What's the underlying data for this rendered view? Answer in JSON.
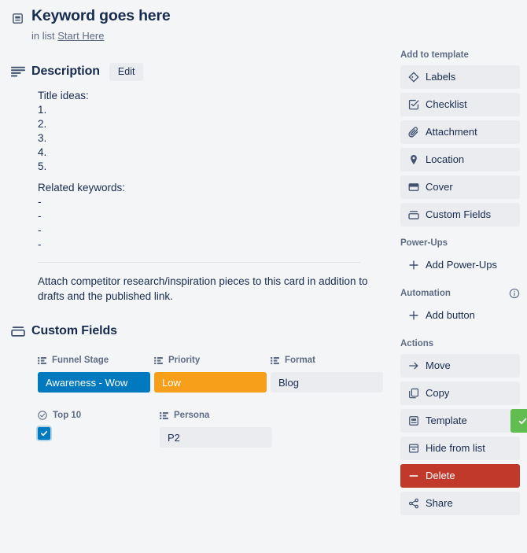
{
  "header": {
    "icon": "template-card-icon",
    "title": "Keyword goes here",
    "in_list_prefix": "in list",
    "list_name": "Start Here"
  },
  "description": {
    "icon": "description-lines-icon",
    "title": "Description",
    "edit_label": "Edit",
    "lines": [
      "Title ideas:",
      "1.",
      "2.",
      "3.",
      "4.",
      "5."
    ],
    "lines2": [
      "Related keywords:",
      "-",
      "-",
      "-",
      "-"
    ],
    "note": "Attach competitor research/inspiration pieces to this card in addition to drafts and the published link."
  },
  "custom_fields": {
    "icon": "custom-fields-icon",
    "title": "Custom Fields",
    "rows": [
      [
        {
          "label": "Funnel Stage",
          "icon": "dropdown-list-icon",
          "value": "Awareness - Wow",
          "style": "blue",
          "type": "badge"
        },
        {
          "label": "Priority",
          "icon": "dropdown-list-icon",
          "value": "Low",
          "style": "orange",
          "type": "badge"
        },
        {
          "label": "Format",
          "icon": "dropdown-list-icon",
          "value": "Blog",
          "style": "plain",
          "type": "badge"
        }
      ],
      [
        {
          "label": "Top 10",
          "icon": "check-circle-icon",
          "value": "",
          "style": "checkbox",
          "type": "checkbox",
          "checked": true
        },
        {
          "label": "Persona",
          "icon": "dropdown-list-icon",
          "value": "P2",
          "style": "plain",
          "type": "badge"
        }
      ]
    ]
  },
  "sidebar": {
    "groups": [
      {
        "heading": "Add to template",
        "info": false,
        "items": [
          {
            "label": "Labels",
            "icon": "label-tag-icon",
            "style": "default"
          },
          {
            "label": "Checklist",
            "icon": "checklist-icon",
            "style": "default"
          },
          {
            "label": "Attachment",
            "icon": "paperclip-icon",
            "style": "default"
          },
          {
            "label": "Location",
            "icon": "location-pin-icon",
            "style": "default"
          },
          {
            "label": "Cover",
            "icon": "cover-image-icon",
            "style": "default"
          },
          {
            "label": "Custom Fields",
            "icon": "custom-fields-icon",
            "style": "default"
          }
        ]
      },
      {
        "heading": "Power-Ups",
        "info": false,
        "items": [
          {
            "label": "Add Power-Ups",
            "icon": "plus-icon",
            "style": "plain"
          }
        ]
      },
      {
        "heading": "Automation",
        "info": true,
        "info_icon": "info-circle-icon",
        "items": [
          {
            "label": "Add button",
            "icon": "plus-icon",
            "style": "plain"
          }
        ]
      },
      {
        "heading": "Actions",
        "info": false,
        "items": [
          {
            "label": "Move",
            "icon": "arrow-right-icon",
            "style": "default"
          },
          {
            "label": "Copy",
            "icon": "copy-icon",
            "style": "default"
          },
          {
            "label": "Template",
            "icon": "template-card-icon",
            "style": "default",
            "badge": "check-icon"
          },
          {
            "label": "Hide from list",
            "icon": "archive-box-icon",
            "style": "default"
          },
          {
            "label": "Delete",
            "icon": "minus-icon",
            "style": "danger"
          },
          {
            "label": "Share",
            "icon": "share-nodes-icon",
            "style": "default"
          }
        ]
      }
    ]
  },
  "colors": {
    "page_bg": "#f4f5f7",
    "text_primary": "#172b4d",
    "text_muted": "#5e6c84",
    "button_bg": "#ebecf0",
    "accent_blue": "#0079bf",
    "accent_orange": "#f79f1a",
    "accent_green": "#61bd4f",
    "accent_red": "#c0392b"
  }
}
